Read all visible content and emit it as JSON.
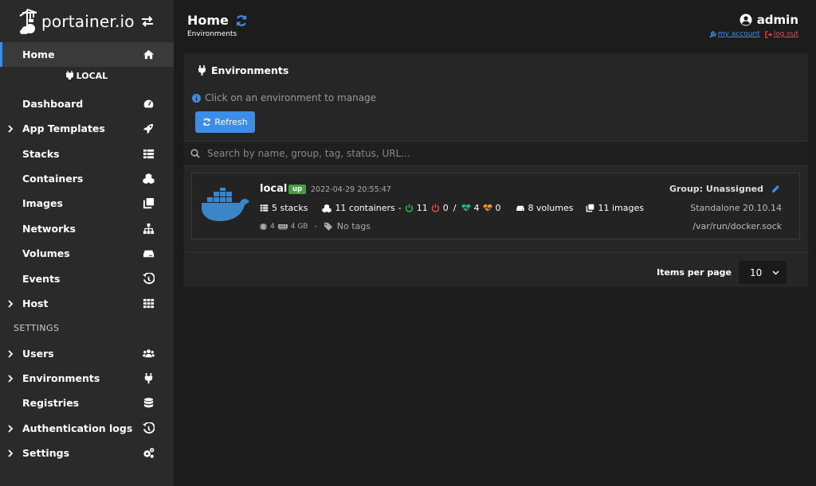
{
  "app": {
    "logo_text": "portainer.io"
  },
  "sidebar": {
    "home": "Home",
    "environment_label": "LOCAL",
    "items": [
      {
        "label": "Dashboard",
        "icon": "tachometer-icon"
      },
      {
        "label": "App Templates",
        "icon": "rocket-icon",
        "expandable": true
      },
      {
        "label": "Stacks",
        "icon": "th-list-icon"
      },
      {
        "label": "Containers",
        "icon": "cubes-icon"
      },
      {
        "label": "Images",
        "icon": "clone-icon"
      },
      {
        "label": "Networks",
        "icon": "sitemap-icon"
      },
      {
        "label": "Volumes",
        "icon": "hdd-icon"
      },
      {
        "label": "Events",
        "icon": "history-icon"
      },
      {
        "label": "Host",
        "icon": "th-icon",
        "expandable": true
      }
    ],
    "settings_label": "SETTINGS",
    "settings_items": [
      {
        "label": "Users",
        "icon": "users-icon",
        "expandable": true
      },
      {
        "label": "Environments",
        "icon": "plug-icon",
        "expandable": true
      },
      {
        "label": "Registries",
        "icon": "database-icon"
      },
      {
        "label": "Authentication logs",
        "icon": "history-icon",
        "expandable": true
      },
      {
        "label": "Settings",
        "icon": "cogs-icon",
        "expandable": true
      }
    ]
  },
  "header": {
    "title": "Home",
    "breadcrumb": "Environments",
    "user": "admin",
    "my_account": "my account",
    "log_out": "log out"
  },
  "panel": {
    "title": "Environments",
    "info": "Click on an environment to manage",
    "refresh": "Refresh",
    "search_placeholder": "Search by name, group, tag, status, URL..."
  },
  "environment": {
    "name": "local",
    "status": "up",
    "date": "2022-04-29 20:55:47",
    "stacks": "5 stacks",
    "containers": "11 containers",
    "running": "11",
    "stopped": "0",
    "healthy": "4",
    "unhealthy": "0",
    "volumes": "8 volumes",
    "images": "11 images",
    "cpu": "4",
    "memory": "4 GB",
    "tags": "No tags",
    "group": "Group: Unassigned",
    "engine": "Standalone 20.10.14",
    "socket": "/var/run/docker.sock"
  },
  "pagination": {
    "label": "Items per page",
    "value": "10"
  },
  "colors": {
    "accent": "#3b8de8",
    "up": "#40a140",
    "running": "#2eb84c",
    "stopped": "#e04b4b",
    "healthy": "#1fb59a",
    "unhealthy": "#e8962e",
    "docker": "#3a86c8"
  }
}
